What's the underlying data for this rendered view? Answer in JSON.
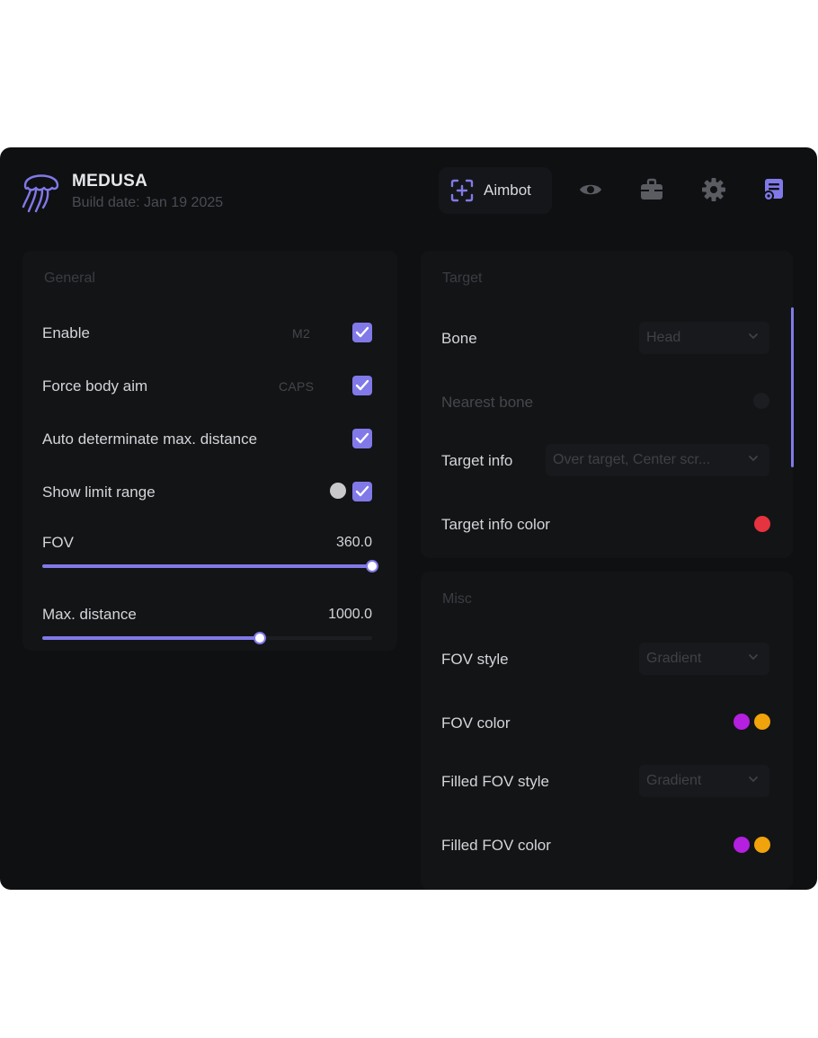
{
  "header": {
    "title": "MEDUSA",
    "build_date": "Build date: Jan 19 2025",
    "tabs": [
      {
        "label": "Aimbot",
        "icon": "crosshair-plus-icon",
        "active": true
      },
      {
        "label": "",
        "icon": "eye-icon"
      },
      {
        "label": "",
        "icon": "briefcase-icon"
      },
      {
        "label": "",
        "icon": "gear-icon"
      },
      {
        "label": "",
        "icon": "config-list-icon"
      }
    ]
  },
  "general": {
    "title": "General",
    "enable": {
      "label": "Enable",
      "key": "M2",
      "checked": true
    },
    "force_body_aim": {
      "label": "Force body aim",
      "key": "CAPS",
      "checked": true
    },
    "auto_max_distance": {
      "label": "Auto determinate max. distance",
      "checked": true
    },
    "show_limit_range": {
      "label": "Show limit range",
      "checked": true,
      "color": "#c9c9cc"
    },
    "fov": {
      "label": "FOV",
      "value": "360.0",
      "fraction": 1.0
    },
    "max_distance": {
      "label": "Max. distance",
      "value": "1000.0",
      "fraction": 0.66
    }
  },
  "target": {
    "title": "Target",
    "bone": {
      "label": "Bone",
      "selected": "Head"
    },
    "nearest_bone": {
      "label": "Nearest bone"
    },
    "target_info": {
      "label": "Target info",
      "selected": "Over target, Center scr..."
    },
    "target_info_color": {
      "label": "Target info color",
      "color": "#e5333f"
    }
  },
  "misc": {
    "title": "Misc",
    "fov_style": {
      "label": "FOV style",
      "selected": "Gradient"
    },
    "fov_color": {
      "label": "FOV color",
      "colors": [
        "#b41fe0",
        "#f0a30a"
      ]
    },
    "filled_fov_style": {
      "label": "Filled FOV style",
      "selected": "Gradient"
    },
    "filled_fov_color": {
      "label": "Filled FOV color",
      "colors": [
        "#b41fe0",
        "#f0a30a"
      ]
    }
  },
  "colors": {
    "accent": "#8179e8",
    "background": "#0f1012",
    "panel": "#131416"
  }
}
